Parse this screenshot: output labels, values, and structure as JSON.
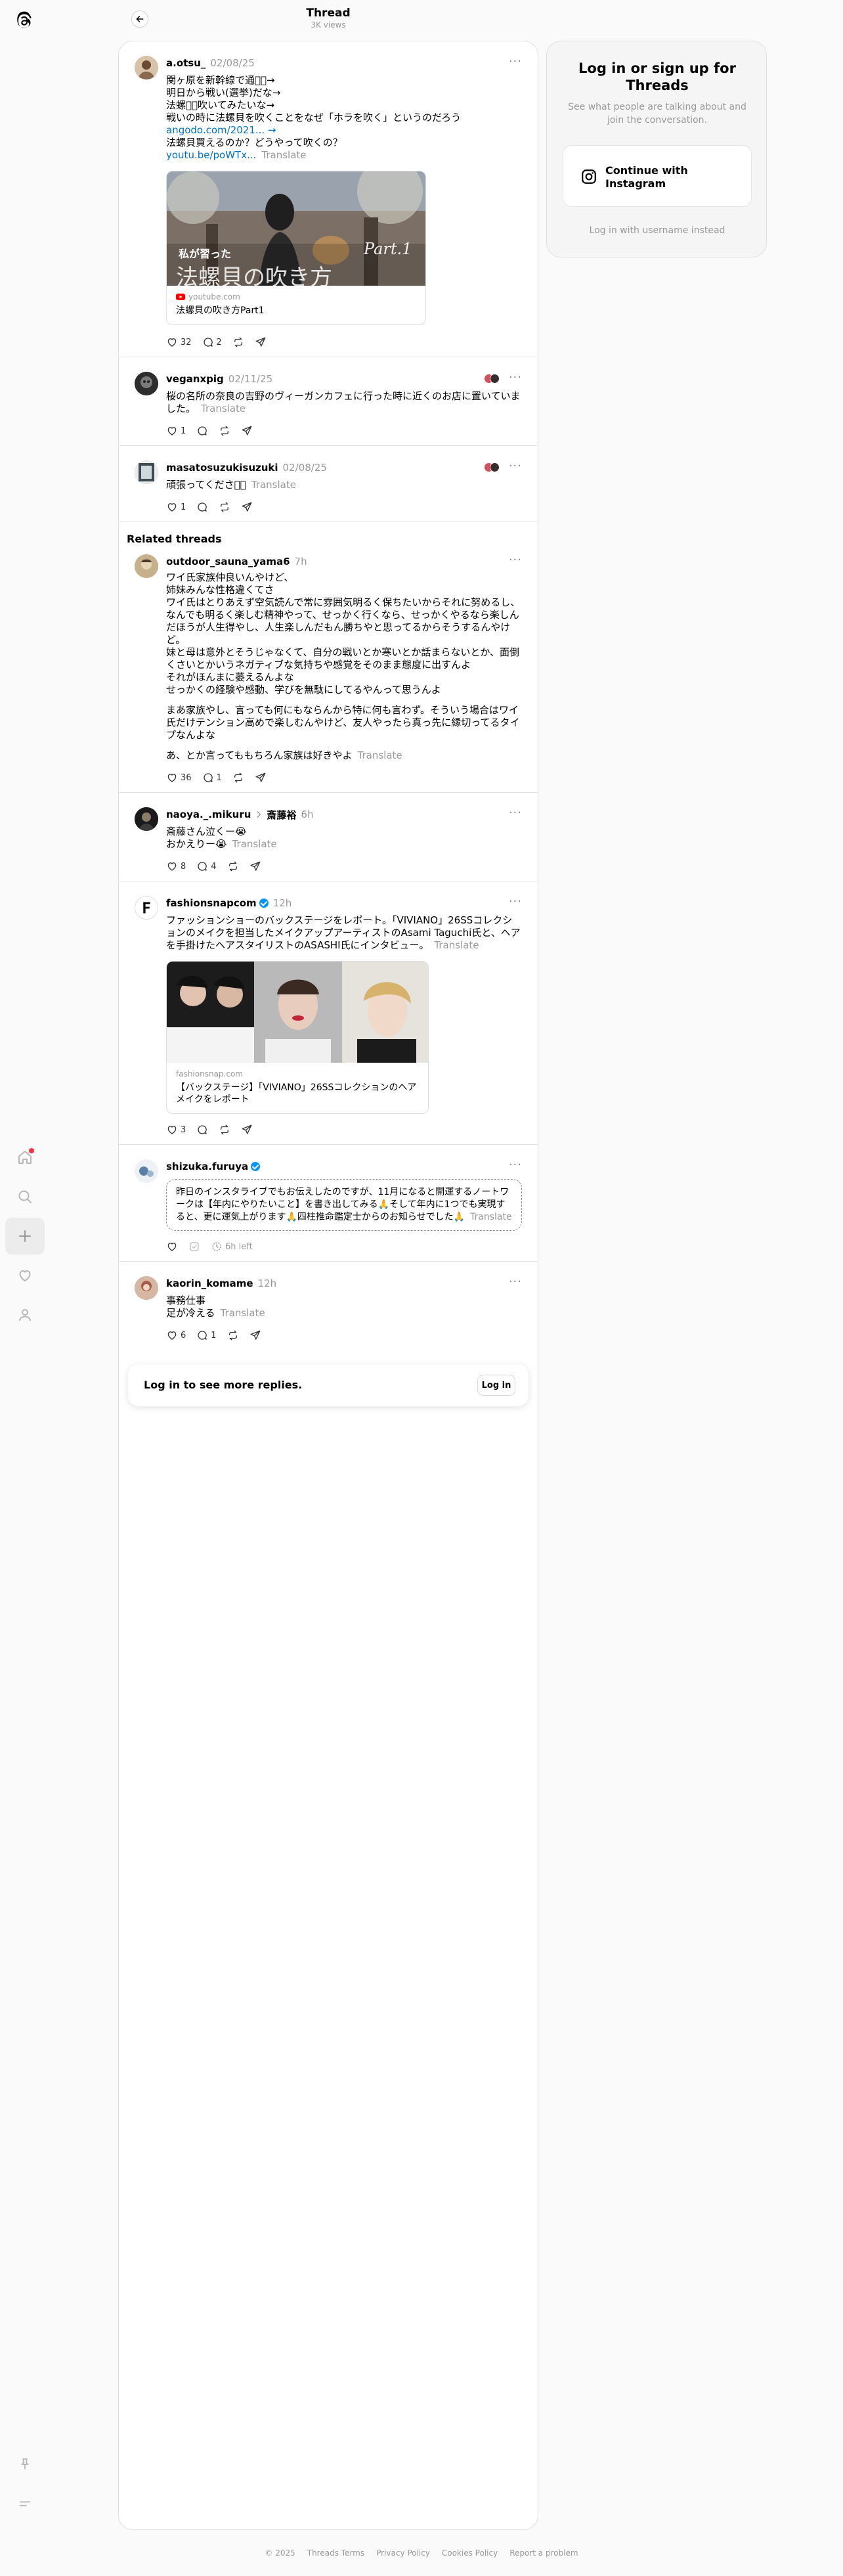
{
  "header": {
    "title": "Thread",
    "views": "3K views"
  },
  "main_post": {
    "username": "a.otsu_",
    "time": "02/08/25",
    "lines": [
      "関ヶ原を新幹線で通過🏻→",
      "明日から戦い(選挙)だな→",
      "法螺貝🏻吹いてみたいな→",
      "戦いの時に法螺貝を吹くことをなぜ「ホラを吹く」というのだろう"
    ],
    "link1": "angodo.com/2021... →",
    "line5": "法螺貝買えるのか？どうやって吹くの？",
    "link2": "youtu.be/poWTx...",
    "translate": "Translate",
    "card": {
      "image_text": "私が習った",
      "image_title": "法螺貝の吹き方",
      "image_tag": "Part.1",
      "domain": "youtube.com",
      "title": "法螺貝の吹き方Part1"
    },
    "likes": "32",
    "replies": "2"
  },
  "replies": [
    {
      "username": "veganxpig",
      "time": "02/11/25",
      "text": "桜の名所の奈良の吉野のヴィーガンカフェに行った時に近くのお店に置いていました。",
      "translate": "Translate",
      "likes": "1"
    },
    {
      "username": "masatosuzukisuzuki",
      "time": "02/08/25",
      "text": "頑張ってください🏻",
      "translate": "Translate",
      "likes": "1"
    }
  ],
  "related_title": "Related threads",
  "related": [
    {
      "username": "outdoor_sauna_yama6",
      "time": "7h",
      "text": "ワイ氏家族仲良いんやけど、\n姉妹みんな性格違くてさ\nワイ氏はとりあえず空気読んで常に雰囲気明るく保ちたいからそれに努めるし、なんでも明るく楽しむ精神やって、せっかく行くなら、せっかくやるなら楽しんだほうが人生得やし、人生楽しんだもん勝ちやと思ってるからそうするんやけど。\n妹と母は意外とそうじゃなくて、自分の戦いとか寒いとか話まらないとか、面倒くさいとかいうネガティブな気持ちや感覚をそのまま態度に出すんよ\nそれがほんまに萎えるんよな\nせっかくの経験や感動、学びを無駄にしてるやんって思うんよ",
      "text2": "まあ家族やし、言っても何にもならんから特に何も言わず。そういう場合はワイ氏だけテンション高めで楽しむんやけど、友人やったら真っ先に縁切ってるタイプなんよな",
      "text3": "あ、とか言ってももちろん家族は好きやよ",
      "translate": "Translate",
      "likes": "36",
      "replies": "1"
    },
    {
      "username": "naoya._.mikuru",
      "tagged": "斎藤裕",
      "time": "6h",
      "text": "斎藤さん泣くー😭\nおかえりー😭",
      "translate": "Translate",
      "likes": "8",
      "replies": "4"
    },
    {
      "username": "fashionsnapcom",
      "time": "12h",
      "text": "ファッションショーのバックステージをレポート。「VIVIANO」26SSコレクションのメイクを担当したメイクアップアーティストのAsami Taguchi氏と、ヘアを手掛けたヘアスタイリストのASASHI氏にインタビュー。",
      "translate": "Translate",
      "card": {
        "domain": "fashionsnap.com",
        "title": "【バックステージ】「VIVIANO」26SSコレクションのヘアメイクをレポート"
      },
      "likes": "3"
    },
    {
      "username": "shizuka.furuya",
      "time": "",
      "text": "昨日のインスタライブでもお伝えしたのですが、11月になると開運するノートワークは【年内にやりたいこと】を書き出してみる🙏そして年内に1つでも実現すると、更に運気上がります🙏四柱推命鑑定士からのお知らせでした🙏",
      "translate": "Translate",
      "time_left": "6h left"
    },
    {
      "username": "kaorin_komame",
      "time": "12h",
      "text": "事務仕事\n足が冷える",
      "translate": "Translate",
      "likes": "6",
      "replies": "1"
    }
  ],
  "login_banner": {
    "text": "Log in to see more replies.",
    "button": "Log in"
  },
  "login_card": {
    "title": "Log in or sign up for Threads",
    "subtitle": "See what people are talking about and join the conversation.",
    "button": "Continue with Instagram",
    "alt": "Log in with username instead"
  },
  "footer": [
    "© 2025",
    "Threads Terms",
    "Privacy Policy",
    "Cookies Policy",
    "Report a problem"
  ]
}
